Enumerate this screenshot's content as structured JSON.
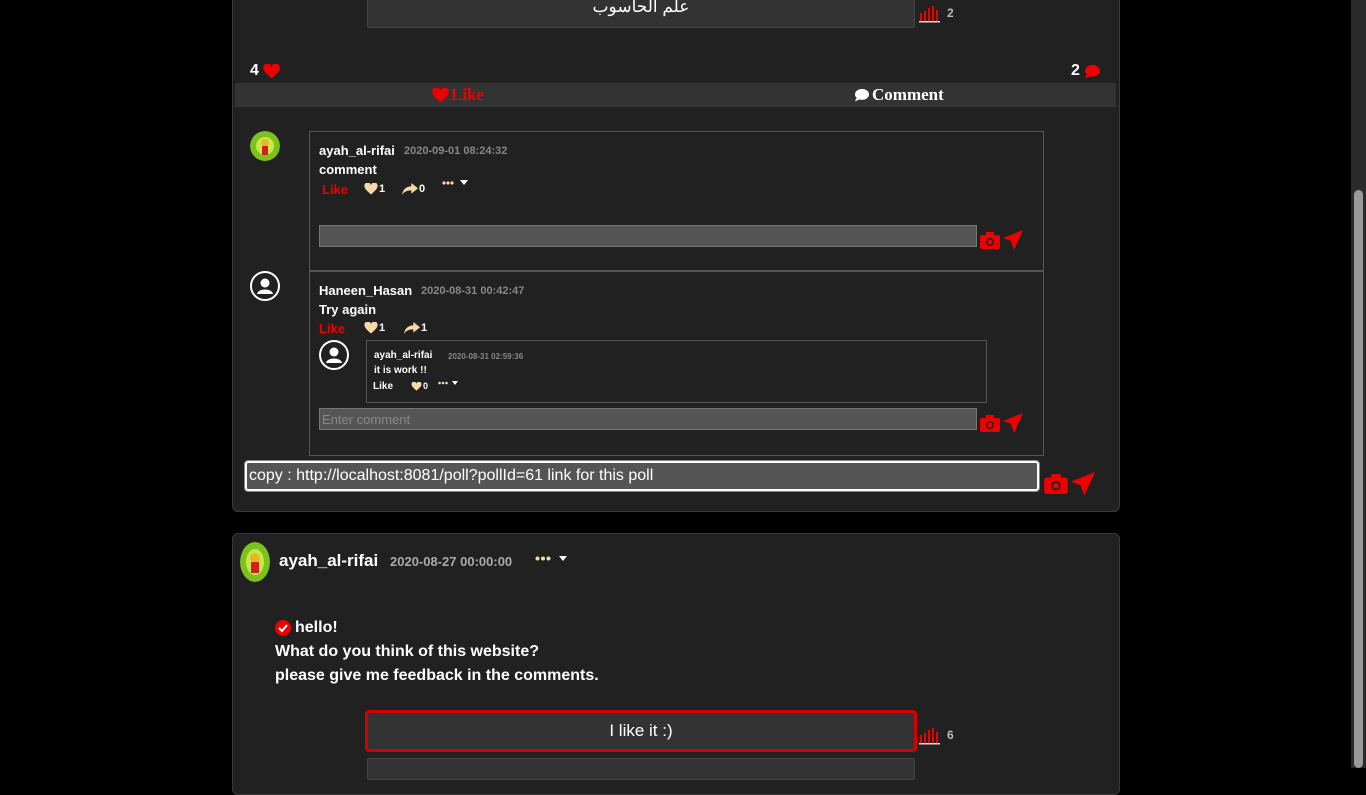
{
  "poll1": {
    "option": {
      "label": "علم الحاسوب",
      "votes": "2"
    },
    "likes_count": "4",
    "comments_count": "2",
    "like_button": "Like",
    "comment_button": "Comment",
    "comments": [
      {
        "user": "ayah_al-rifai",
        "date": "2020-09-01 08:24:32",
        "text": "comment",
        "like_label": "Like",
        "likes": "1",
        "shares": "0",
        "reply_placeholder": ""
      },
      {
        "user": "Haneen_Hasan",
        "date": "2020-08-31 00:42:47",
        "text": "Try again",
        "like_label": "Like",
        "likes": "1",
        "shares": "1",
        "reply": {
          "user": "ayah_al-rifai",
          "date": "2020-08-31 02:59:36",
          "text": "it is work !!",
          "like_label": "Like",
          "likes": "0"
        },
        "reply_placeholder": "Enter comment"
      }
    ],
    "main_input_value": "copy : http://localhost:8081/poll?pollId=61 link for this poll"
  },
  "poll2": {
    "user": "ayah_al-rifai",
    "date": "2020-08-27 00:00:00",
    "title": "hello!",
    "line2": "What do you think of this website?",
    "line3": "please give me feedback in the comments.",
    "option": {
      "label": "I like it :)",
      "votes": "6"
    }
  },
  "colors": {
    "accent": "#e00000",
    "card": "#212121",
    "background": "#000000"
  }
}
